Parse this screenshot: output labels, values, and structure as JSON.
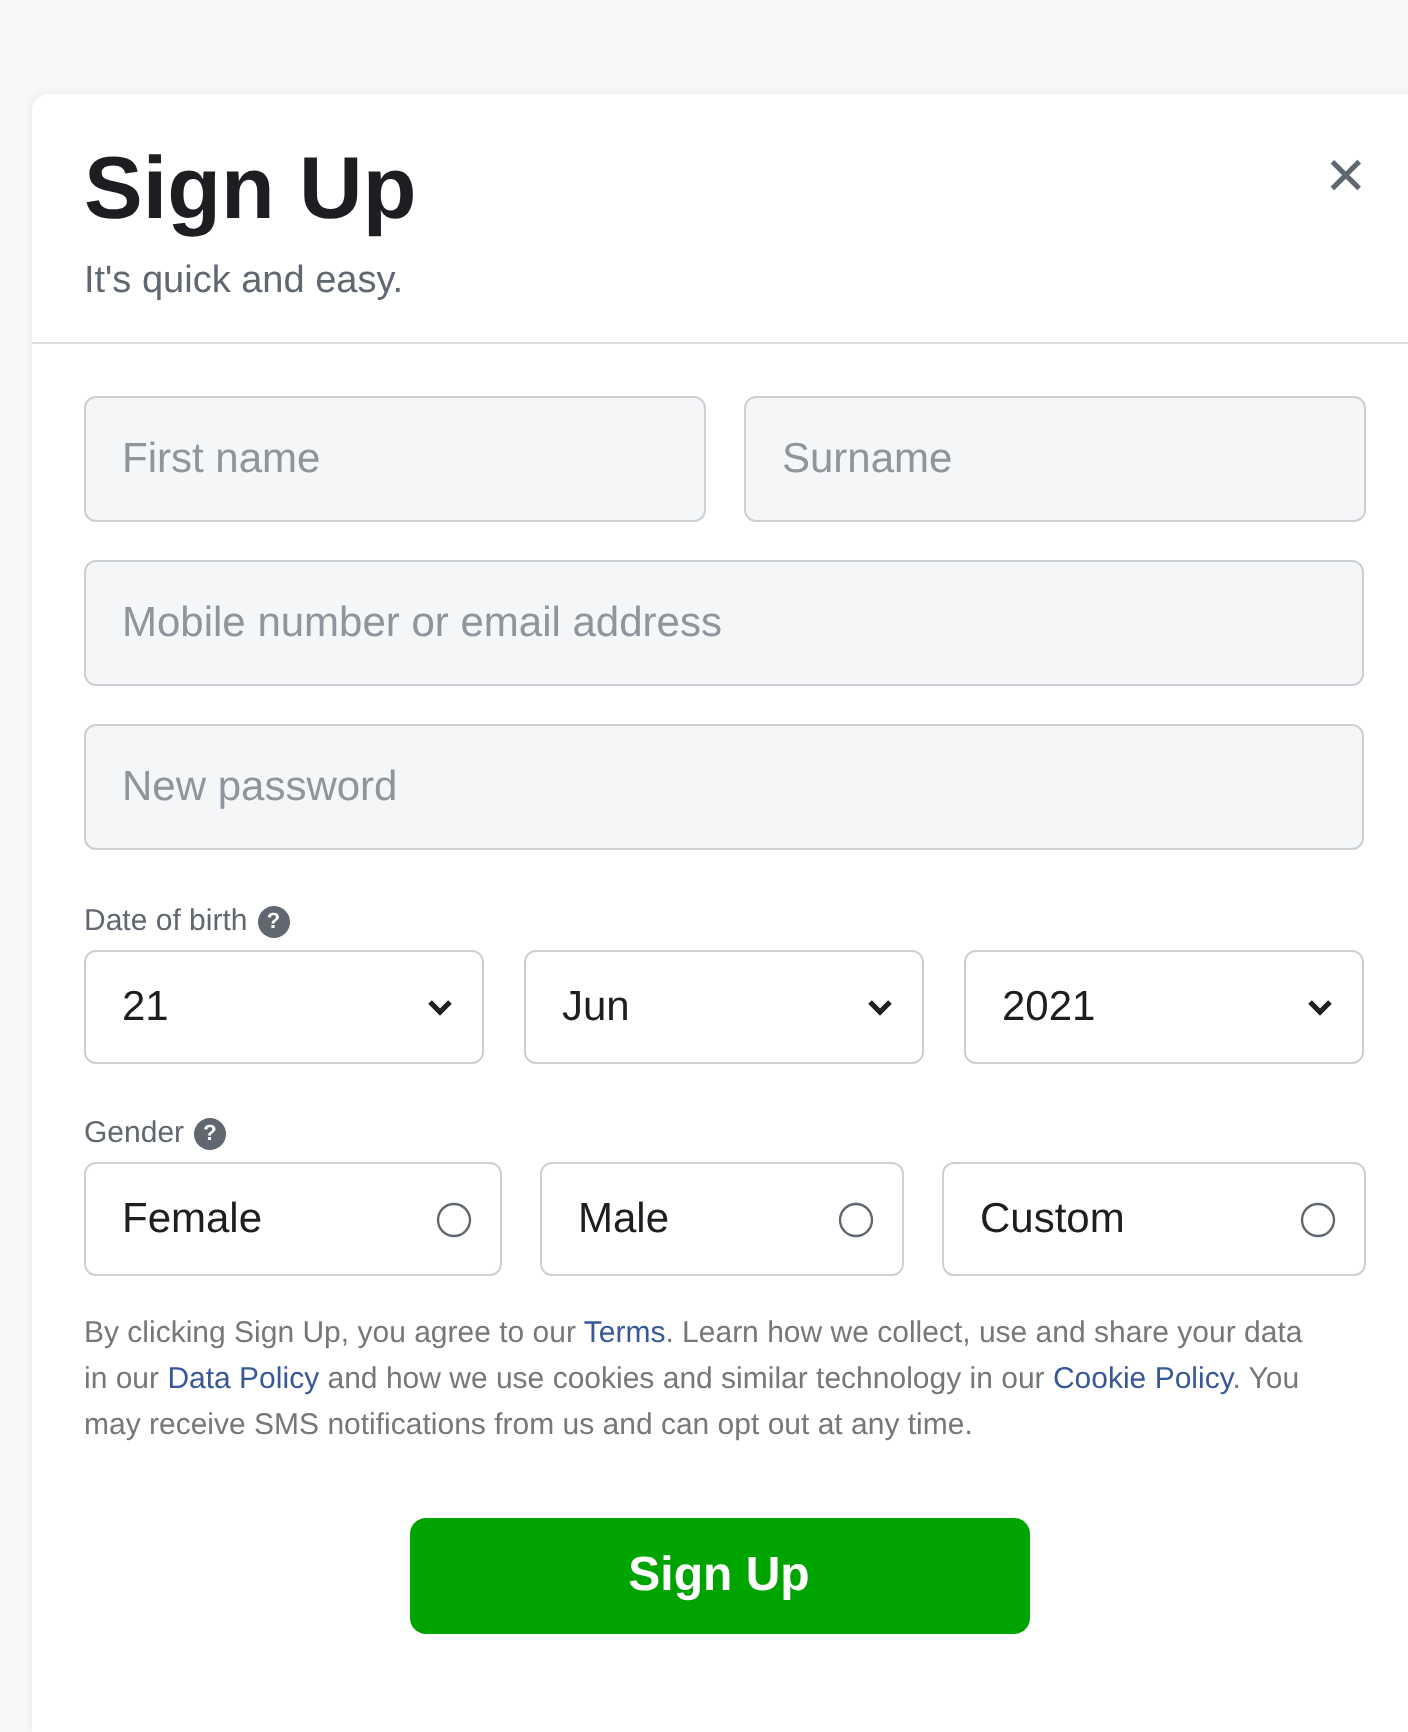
{
  "dialog": {
    "title": "Sign Up",
    "subtitle": "It's quick and easy.",
    "close": "✕"
  },
  "name_fields": [
    {
      "placeholder": "First name"
    },
    {
      "placeholder": "Surname"
    }
  ],
  "fields": [
    {
      "placeholder": "Mobile number or email address"
    },
    {
      "placeholder": "New password"
    }
  ],
  "date_of_birth": {
    "label": "Date of birth",
    "help": "?",
    "selects": [
      {
        "value": "21"
      },
      {
        "value": "Jun"
      },
      {
        "value": "2021"
      }
    ]
  },
  "gender": {
    "label": "Gender",
    "help": "?",
    "options": [
      {
        "label": "Female",
        "selected": false
      },
      {
        "label": "Male",
        "selected": false
      },
      {
        "label": "Custom",
        "selected": false
      }
    ]
  },
  "legal": [
    {
      "text": "By clicking Sign Up, you agree to our ",
      "link": false
    },
    {
      "text": "Terms",
      "link": true
    },
    {
      "text": ". Learn how we collect, use and share your data in our ",
      "link": false
    },
    {
      "text": "Data Policy",
      "link": true
    },
    {
      "text": " and how we use cookies and similar technology in our ",
      "link": false
    },
    {
      "text": "Cookie Policy",
      "link": true
    },
    {
      "text": ". You may receive SMS notifications from us and can opt out at any time.",
      "link": false
    }
  ],
  "submit": "Sign Up"
}
